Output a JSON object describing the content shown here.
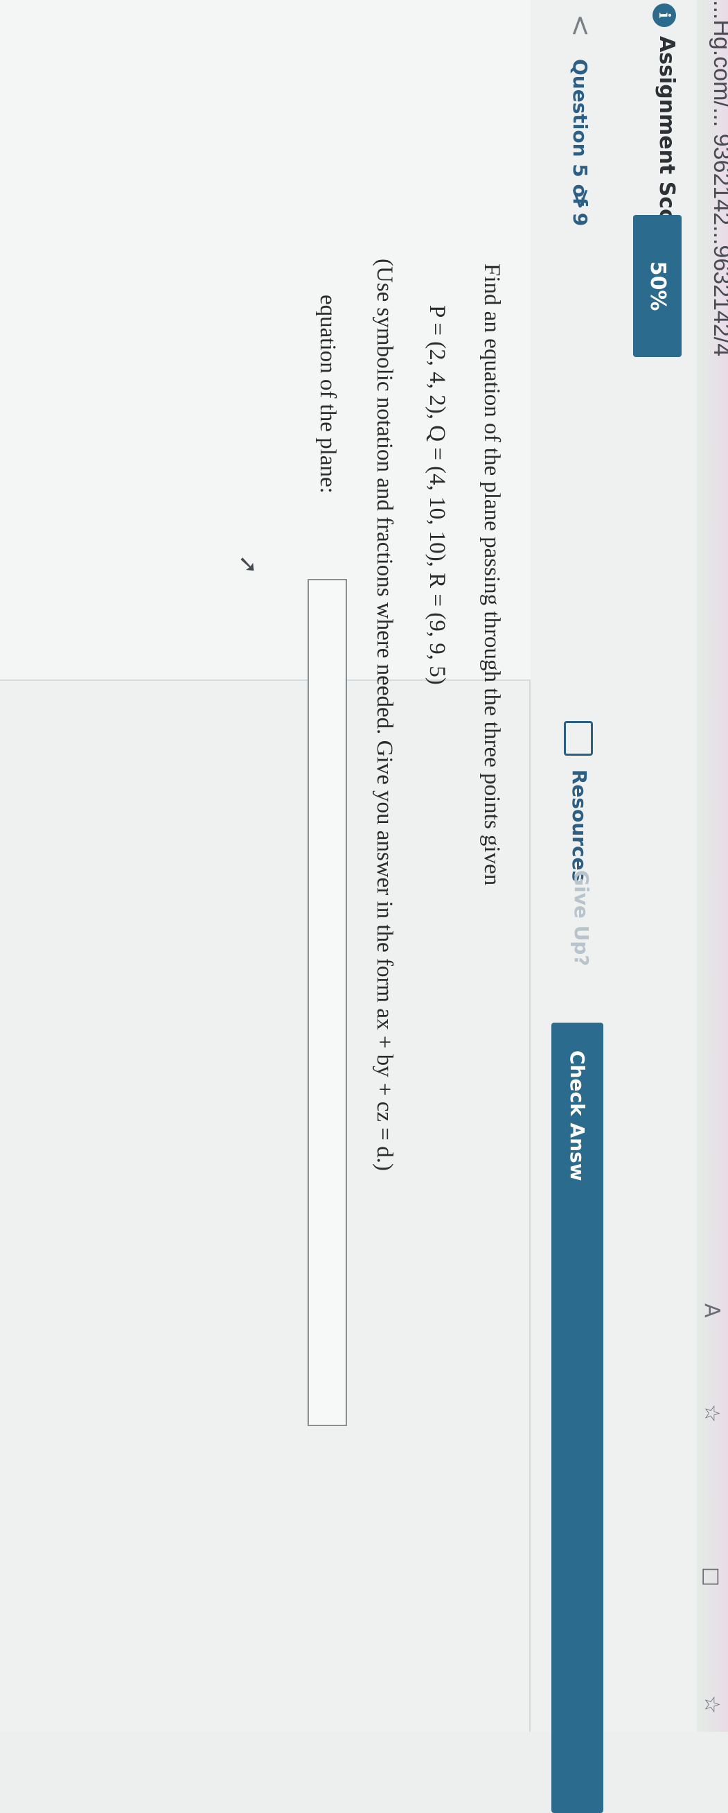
{
  "browser": {
    "url_fragment": "...Hg.com/... 9362142...9632142/4",
    "aa_icon": "A",
    "icons": [
      "reader-mode-icon",
      "favorite-star-icon",
      "split-view-icon",
      "favorites-list-icon"
    ]
  },
  "header": {
    "info_icon": "i",
    "score_label": "Assignment Score:",
    "score_value": "50%"
  },
  "question_bar": {
    "prev_label": "<",
    "question_label": "Question 5 of 9",
    "next_label": ">",
    "resources_label": "Resources",
    "giveup_label": "Give Up?",
    "check_answer_label": "Check Answ"
  },
  "question": {
    "prompt": "Find an equation of the plane passing through the three points given",
    "points": "P = (2, 4, 2), Q = (4, 10, 10), R = (9, 9, 5)",
    "instructions": "(Use symbolic notation and fractions where needed. Give you answer in the form ax + by + cz = d.)",
    "answer_label": "equation of the plane:",
    "answer_value": ""
  },
  "colors": {
    "accent": "#2b6c8e",
    "link": "#2c5f86",
    "disabled": "#b9c3cc"
  }
}
